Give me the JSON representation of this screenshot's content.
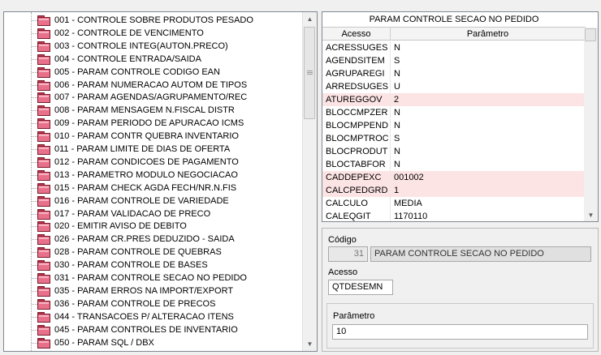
{
  "tree": {
    "items": [
      "001 - CONTROLE SOBRE PRODUTOS PESADO",
      "002 - CONTROLE DE VENCIMENTO",
      "003 - CONTROLE INTEG(AUTON.PRECO)",
      "004 - CONTROLE ENTRADA/SAIDA",
      "005 - PARAM CONTROLE CODIGO EAN",
      "006 - PARAM NUMERACAO AUTOM DE TIPOS",
      "007 - PARAM AGENDAS/AGRUPAMENTO/REC",
      "008 - PARAM MENSAGEM N.FISCAL DISTR",
      "009 - PARAM PERIODO DE APURACAO ICMS",
      "010 - PARAM CONTR QUEBRA INVENTARIO",
      "011 - PARAM LIMITE DE DIAS DE OFERTA",
      "012 - PARAM CONDICOES DE PAGAMENTO",
      "013 - PARAMETRO MODULO NEGOCIACAO",
      "015 - PARAM CHECK AGDA FECH/NR.N.FIS",
      "016 - PARAM CONTROLE DE VARIEDADE",
      "017 - PARAM VALIDACAO DE PRECO",
      "020 - EMITIR AVISO DE DEBITO",
      "026 - PARAM CR.PRES DEDUZIDO - SAIDA",
      "028 - PARAM CONTROLE DE QUEBRAS",
      "030 - PARAM CONTROLE DE BASES",
      "031 - PARAM CONTROLE SECAO NO PEDIDO",
      "035 - PARAM ERROS NA IMPORT/EXPORT",
      "036 - PARAM CONTROLE DE PRECOS",
      "044 - TRANSACOES P/ ALTERACAO ITENS",
      "045 - PARAM CONTROLES DE INVENTARIO",
      "050 - PARAM SQL / DBX"
    ],
    "scroll_position": 0.0
  },
  "grid": {
    "title": "PARAM CONTROLE SECAO NO PEDIDO",
    "headers": [
      "Acesso",
      "Parâmetro"
    ],
    "rows": [
      {
        "acesso": "ACRESSUGES",
        "parametro": "N",
        "highlight": false
      },
      {
        "acesso": "AGENDSITEM",
        "parametro": "S",
        "highlight": false
      },
      {
        "acesso": "AGRUPAREGI",
        "parametro": "N",
        "highlight": false
      },
      {
        "acesso": "ARREDSUGES",
        "parametro": "U",
        "highlight": false
      },
      {
        "acesso": "ATUREGGOV",
        "parametro": "2",
        "highlight": true
      },
      {
        "acesso": "BLOCCMPZER",
        "parametro": "N",
        "highlight": false
      },
      {
        "acesso": "BLOCMPPEND",
        "parametro": "N",
        "highlight": false
      },
      {
        "acesso": "BLOCMPTROC",
        "parametro": "S",
        "highlight": false
      },
      {
        "acesso": "BLOCPRODUT",
        "parametro": "N",
        "highlight": false
      },
      {
        "acesso": "BLOCTABFOR",
        "parametro": "N",
        "highlight": false
      },
      {
        "acesso": "CADDEPEXC",
        "parametro": "001002",
        "highlight": true
      },
      {
        "acesso": "CALCPEDGRD",
        "parametro": "1",
        "highlight": true
      },
      {
        "acesso": "CALCULO",
        "parametro": "MEDIA",
        "highlight": false
      },
      {
        "acesso": "CALEQGIT",
        "parametro": "1170110",
        "highlight": false
      }
    ]
  },
  "form": {
    "codigo_label": "Código",
    "codigo_value": "31",
    "codigo_name": "PARAM CONTROLE SECAO NO PEDIDO",
    "acesso_label": "Acesso",
    "acesso_value": "QTDESEMN",
    "parametro_label": "Parâmetro",
    "parametro_value": "10"
  },
  "colors": {
    "highlight_row": "#fde4e4",
    "folder": "#e8708a"
  }
}
